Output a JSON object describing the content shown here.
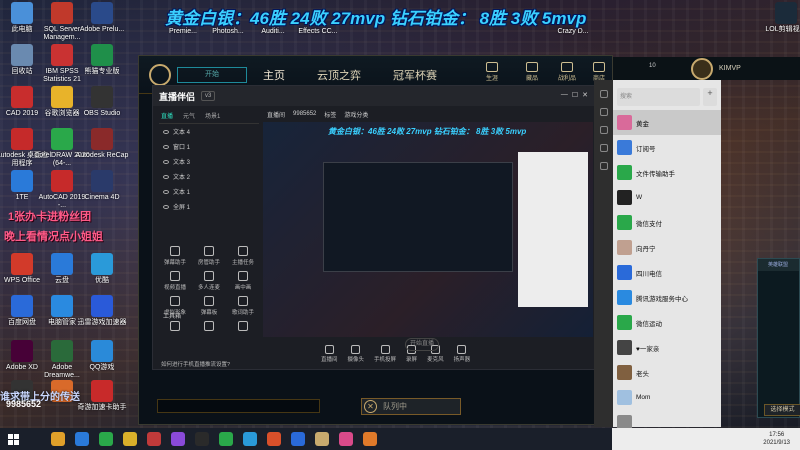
{
  "banner": "黄金白银：46胜 24败 27mvp 钻石铂金：  8胜 3败 5mvp",
  "desktop_icons": [
    {
      "label": "此电脑",
      "color": "#4a90d9"
    },
    {
      "label": "SQL Server Managem...",
      "color": "#c0392b"
    },
    {
      "label": "Adobe Prelu...",
      "color": "#2a4a8a"
    },
    {
      "label": "回收站",
      "color": "#6a8ab0"
    },
    {
      "label": "IBM SPSS Statistics 21",
      "color": "#c93232"
    },
    {
      "label": "熊猫专业版",
      "color": "#1f8f4a"
    },
    {
      "label": "CAD 2019",
      "color": "#c82d2d"
    },
    {
      "label": "谷歌浏览器",
      "color": "#e8b32a"
    },
    {
      "label": "OBS Studio",
      "color": "#333333"
    },
    {
      "label": "Autodesk 桌面应用程序",
      "color": "#c52a2a"
    },
    {
      "label": "CorelDRAW 2020 (64-...",
      "color": "#2aa84a"
    },
    {
      "label": "Autodesk ReCap",
      "color": "#8a2a2a"
    },
    {
      "label": "1TE",
      "color": "#2a7ad9"
    },
    {
      "label": "AutoCAD 2019 -...",
      "color": "#c62a2a"
    },
    {
      "label": "Cinema 4D",
      "color": "#2a3a6a"
    },
    {
      "label": "WPS Office",
      "color": "#d23a2a"
    },
    {
      "label": "云盘",
      "color": "#2a7ad9"
    },
    {
      "label": "优酷",
      "color": "#2a9ad9"
    },
    {
      "label": "百度网盘",
      "color": "#2a6ad9"
    },
    {
      "label": "电脑管家",
      "color": "#2a8ae0"
    },
    {
      "label": "迅雷游戏加速器",
      "color": "#2a5ad9"
    },
    {
      "label": "Adobe XD",
      "color": "#470137"
    },
    {
      "label": "Adobe Dreamwe...",
      "color": "#2a6a3a"
    },
    {
      "label": "QQ游戏",
      "color": "#2a8ad9"
    },
    {
      "label": "",
      "color": "#333333"
    },
    {
      "label": "",
      "color": "#d96a2a"
    },
    {
      "label": "奇游加速卡助手",
      "color": "#c82a2a"
    }
  ],
  "top_shortcuts": [
    "Premie...",
    "Photosh...",
    "Auditi...",
    "Effects CC...",
    "Crazy D..."
  ],
  "overlay": {
    "ribbon1": "1张办卡进粉丝团",
    "ribbon2": "晚上看情况点小姐姐",
    "watermark": "谁求带上分的传送",
    "watermark_id": "9985652"
  },
  "lol": {
    "play_label": "开始",
    "nav": [
      "主页",
      "云顶之弈",
      "冠军杯赛"
    ],
    "right_nav": [
      "生涯",
      "藏品",
      "战利品",
      "商店"
    ],
    "level": "10",
    "username": "KIMVP",
    "queue_label": "队列中"
  },
  "live": {
    "brand": "直播伴侣",
    "version": "v3",
    "scene_tabs": [
      "直播",
      "元气",
      "场景1"
    ],
    "sources": [
      "文本 4",
      "窗口 1",
      "文本 3",
      "文本 2",
      "文本 1",
      "全屏 1"
    ],
    "tools_label": "工具箱",
    "tools": [
      "弹幕助手",
      "房管助手",
      "主播任务",
      "视频直播",
      "多人连麦",
      "画中画",
      "虚拟形象",
      "弹幕板",
      "歌词助手",
      "",
      "",
      ""
    ],
    "preview_bar": [
      "直播间",
      "9985652",
      "标签",
      "游戏分类"
    ],
    "preview_banner": "黄金白银：46胜 24败 27mvp 钻石铂金：  8胜 3败 5mvp",
    "bottom_tools": [
      "直播间",
      "摄像头",
      "手机投屏",
      "录屏",
      "麦克风",
      "扬声器"
    ],
    "start_label": "开始直播",
    "footer": "如何进行手机直播推流设置?"
  },
  "wechat": {
    "search_placeholder": "搜索",
    "items": [
      {
        "name": "黄金",
        "sub": "",
        "color": "#d96a9a",
        "selected": true
      },
      {
        "name": "订阅号",
        "sub": "",
        "color": "#3a7ad9",
        "selected": false
      },
      {
        "name": "文件传输助手",
        "sub": "",
        "color": "#2aa84a",
        "selected": false
      },
      {
        "name": "W",
        "sub": "",
        "color": "#222222",
        "selected": false
      },
      {
        "name": "微信支付",
        "sub": "",
        "color": "#2aa84a",
        "selected": false
      },
      {
        "name": "向丹宁",
        "sub": "",
        "color": "#c0a090",
        "selected": false
      },
      {
        "name": "四川电信",
        "sub": "",
        "color": "#2a6ad9",
        "selected": false
      },
      {
        "name": "腾讯游戏服务中心",
        "sub": "",
        "color": "#2a8ae0",
        "selected": false
      },
      {
        "name": "微信运动",
        "sub": "",
        "color": "#2aa84a",
        "selected": false
      },
      {
        "name": "♥一家亲",
        "sub": "",
        "color": "#444444",
        "selected": false
      },
      {
        "name": "老头",
        "sub": "",
        "color": "#806040",
        "selected": false
      },
      {
        "name": "Mom",
        "sub": "",
        "color": "#a0c0e0",
        "selected": false
      },
      {
        "name": "",
        "sub": "",
        "color": "#8a8a8a",
        "selected": false
      }
    ]
  },
  "game_card": {
    "header": "英雄联盟",
    "button": "选择模式"
  },
  "taskbar": {
    "apps": [
      "#e0a02a",
      "#2a7ad9",
      "#2aa84a",
      "#d9b02a",
      "#c03a3a",
      "#8a4ad9",
      "#2a2a2a",
      "#2aa84a",
      "#2a9ad9",
      "#d9502a",
      "#2a6ad9",
      "#c8aa6e",
      "#d94a8a",
      "#e07a2a"
    ],
    "time": "17:56",
    "date": "2021/9/13"
  },
  "tray_app_name": "LOL剪辑视频"
}
